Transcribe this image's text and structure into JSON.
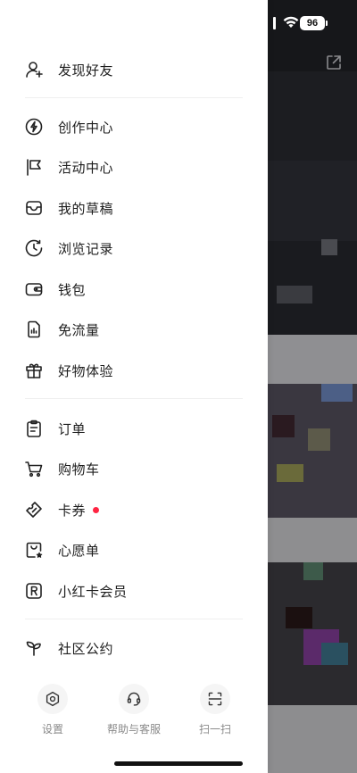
{
  "status_bar": {
    "battery": "96"
  },
  "drawer": {
    "top_item": {
      "label": "发现好友",
      "icon": "add-friend-icon"
    },
    "group1": [
      {
        "key": "creation",
        "label": "创作中心",
        "icon": "lightning-icon"
      },
      {
        "key": "activity",
        "label": "活动中心",
        "icon": "flag-icon"
      },
      {
        "key": "drafts",
        "label": "我的草稿",
        "icon": "inbox-icon"
      },
      {
        "key": "history",
        "label": "浏览记录",
        "icon": "history-clock-icon"
      },
      {
        "key": "wallet",
        "label": "钱包",
        "icon": "wallet-icon"
      },
      {
        "key": "free-data",
        "label": "免流量",
        "icon": "sim-data-icon"
      },
      {
        "key": "goods-trial",
        "label": "好物体验",
        "icon": "gift-icon"
      }
    ],
    "group2": [
      {
        "key": "orders",
        "label": "订单",
        "icon": "clipboard-icon"
      },
      {
        "key": "cart",
        "label": "购物车",
        "icon": "cart-icon"
      },
      {
        "key": "coupons",
        "label": "卡券",
        "icon": "ticket-icon",
        "badge": true
      },
      {
        "key": "wishlist",
        "label": "心愿单",
        "icon": "wishlist-bag-icon"
      },
      {
        "key": "membership",
        "label": "小红卡会员",
        "icon": "member-card-icon"
      }
    ],
    "group3": [
      {
        "key": "community",
        "label": "社区公约",
        "icon": "sprout-icon"
      }
    ],
    "bottom": [
      {
        "key": "settings",
        "label": "设置",
        "icon": "gear-icon"
      },
      {
        "key": "help",
        "label": "帮助与客服",
        "icon": "headset-icon"
      },
      {
        "key": "scan",
        "label": "扫一扫",
        "icon": "scan-icon"
      }
    ]
  },
  "colors": {
    "badge": "#ff2442",
    "text": "#1e1e1e",
    "muted": "#8a8a8a"
  }
}
